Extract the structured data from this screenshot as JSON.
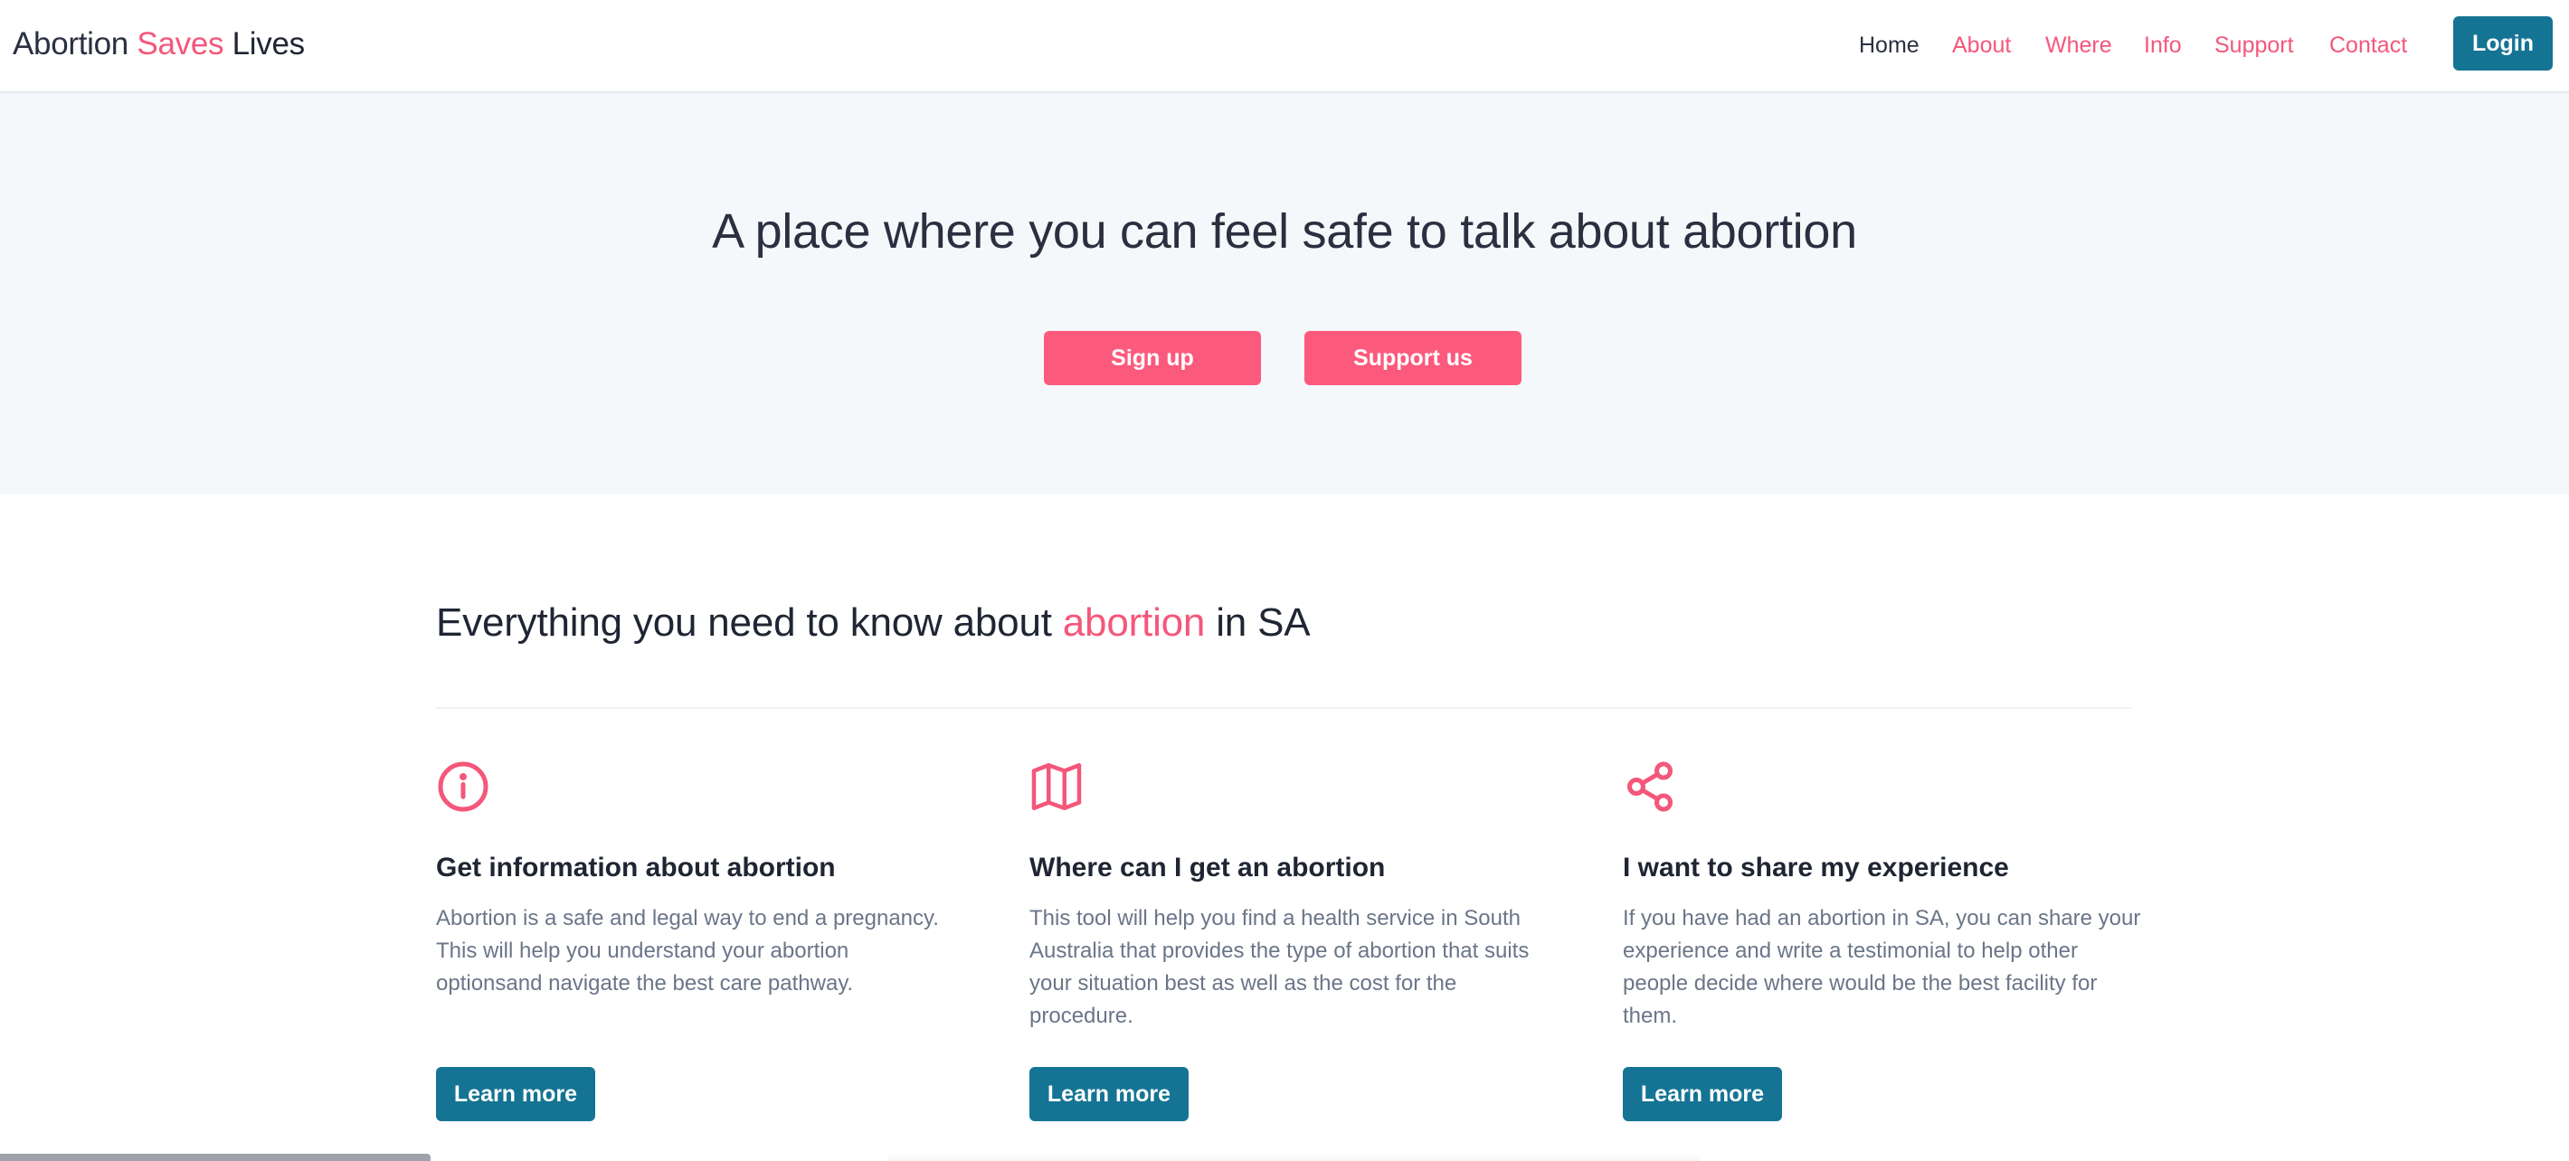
{
  "brand": {
    "part1": "Abortion",
    "part2": "Saves",
    "part3": "Lives"
  },
  "nav": {
    "items": [
      {
        "label": "Home"
      },
      {
        "label": "About"
      },
      {
        "label": "Where"
      },
      {
        "label": "Info"
      },
      {
        "label": "Support"
      },
      {
        "label": "Contact"
      }
    ],
    "login_label": "Login"
  },
  "hero": {
    "title": "A place where you can feel safe to talk about abortion",
    "signup_label": "Sign up",
    "support_label": "Support us"
  },
  "features": {
    "heading_pre": "Everything you need to know about",
    "heading_accent": "abortion",
    "heading_post": "in SA",
    "cards": [
      {
        "icon": "info-circle-icon",
        "title": "Get information about abortion",
        "text": "Abortion is a safe and legal way to end a pregnancy. This will help you understand your abortion optionsand navigate the best care pathway.",
        "button": "Learn more"
      },
      {
        "icon": "map-icon",
        "title": "Where can I get an abortion",
        "text": "This tool will help you find a health service in South Australia that provides the type of abortion that suits your situation best as well as the cost for the procedure.",
        "button": "Learn more"
      },
      {
        "icon": "share-icon",
        "title": "I want to share my experience",
        "text": "If you have had an abortion in SA, you can share your experience and write a testimonial to help other people decide where would be the best facility for them.",
        "button": "Learn more"
      }
    ]
  },
  "colors": {
    "accent_pink": "#f4577a",
    "button_pink": "#fc5a7d",
    "primary_teal": "#157494",
    "hero_bg": "#f5f8fb",
    "text_dark": "#1f2533",
    "text_muted": "#6b7588"
  }
}
